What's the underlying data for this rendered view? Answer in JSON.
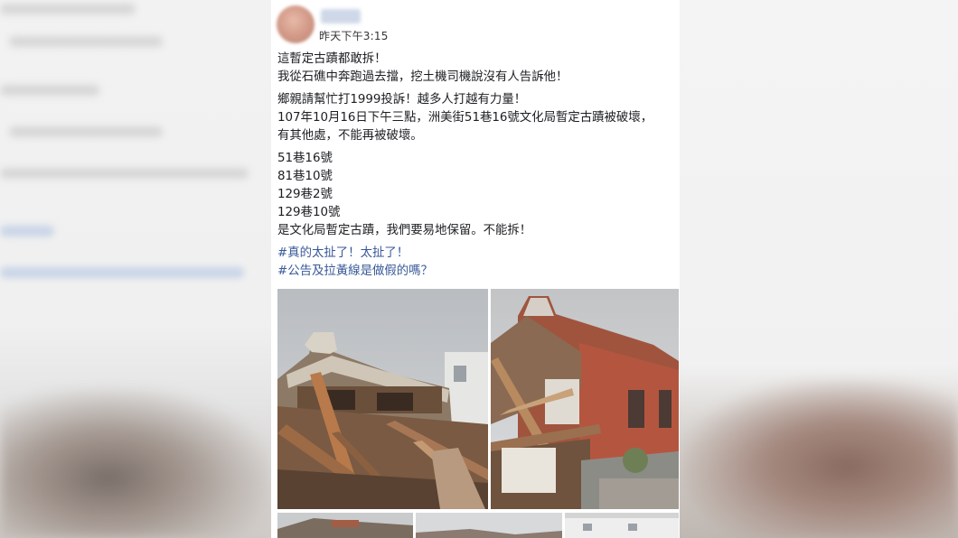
{
  "post": {
    "timestamp": "昨天下午3:15",
    "lines": [
      "這暫定古蹟都敢拆！",
      "我從石礁中奔跑過去擋，挖土機司機說沒有人告訴他！",
      "鄉親請幫忙打1999投訴！越多人打越有力量！",
      "107年10月16日下午三點，洲美街51巷16號文化局暫定古蹟被破壞，",
      "有其他處，不能再被破壞。",
      "51巷16號",
      "81巷10號",
      "129巷2號",
      "129巷10號",
      "是文化局暫定古蹟，我們要易地保留。不能拆！"
    ],
    "hashtags": [
      "#真的太扯了！太扯了！",
      "#公告及拉黃線是做假的嗎？"
    ]
  },
  "colors": {
    "hashtag": "#385898",
    "text": "#1c1e21",
    "card": "#ffffff"
  }
}
